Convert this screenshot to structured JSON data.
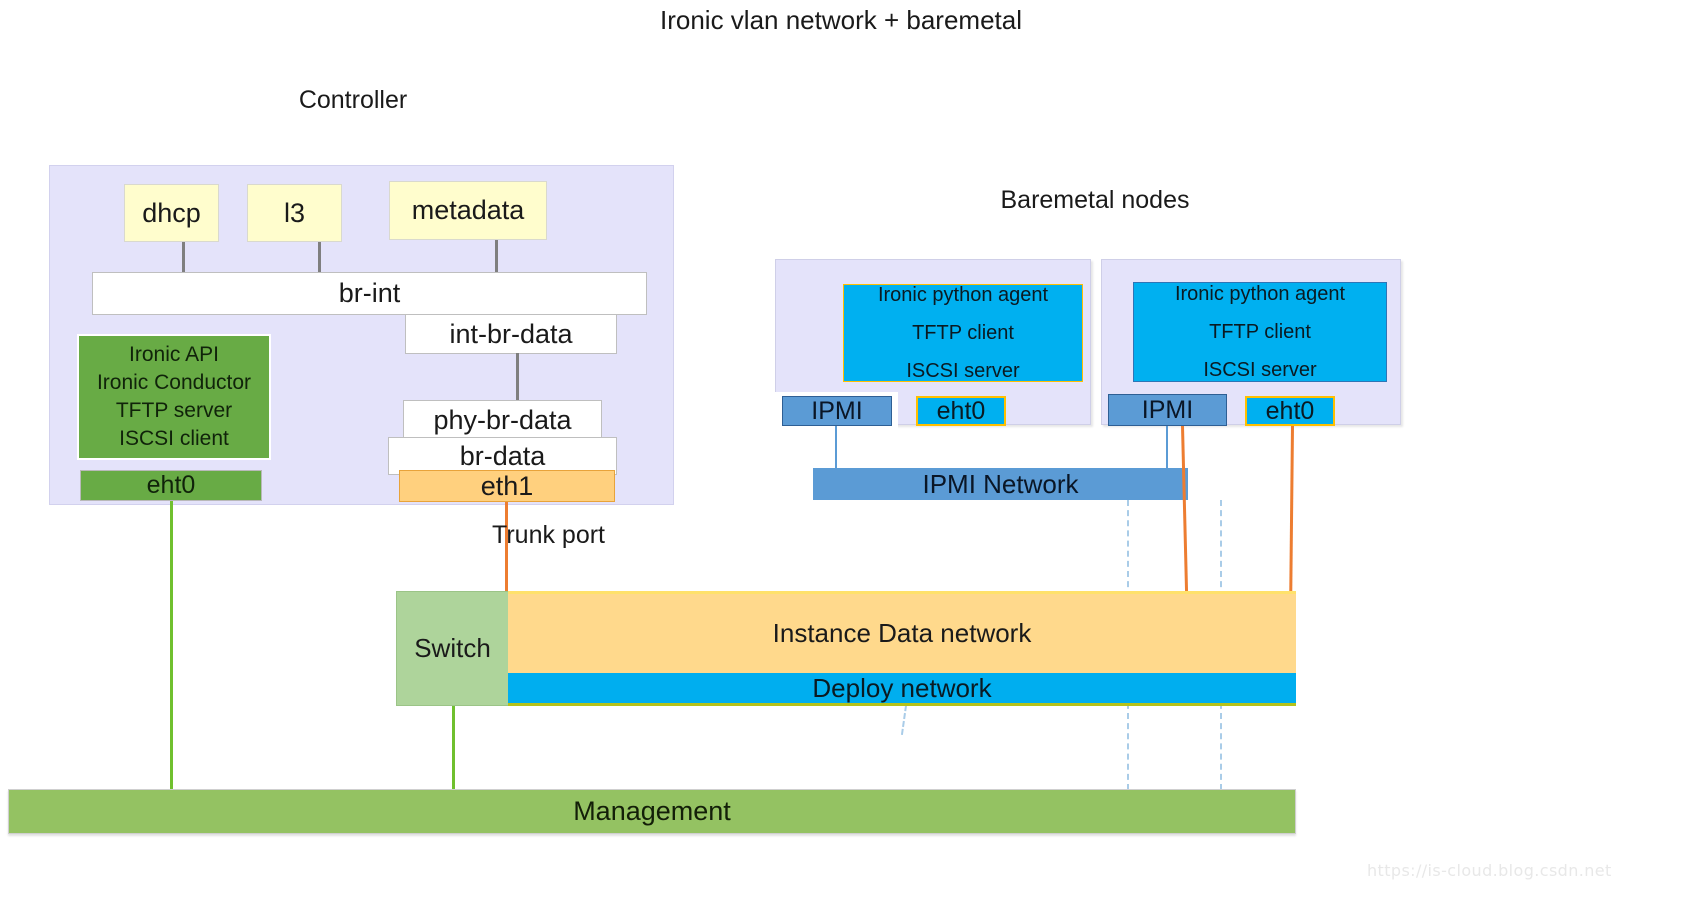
{
  "title": "Ironic vlan network + baremetal",
  "groups": {
    "controller_label": "Controller",
    "baremetal_label": "Baremetal nodes"
  },
  "controller": {
    "agents": [
      {
        "label": "dhcp"
      },
      {
        "label": "l3"
      },
      {
        "label": "metadata"
      }
    ],
    "bridges": {
      "br_int": "br-int",
      "int_br_data": "int-br-data",
      "phy_br_data": "phy-br-data",
      "br_data": "br-data"
    },
    "services": {
      "line1": "Ironic API",
      "line2": "Ironic Conductor",
      "line3": "TFTP server",
      "line4": "ISCSI client"
    },
    "nics": {
      "mgmt_nic": "eht0",
      "data_nic": "eth1"
    },
    "trunk_label": "Trunk port"
  },
  "baremetal_nodes": [
    {
      "services": {
        "line1": "Ironic python agent",
        "line2": "TFTP client",
        "line3": "ISCSI server"
      },
      "ipmi_label": "IPMI",
      "nic_label": "eht0"
    },
    {
      "services": {
        "line1": "Ironic python agent",
        "line2": "TFTP client",
        "line3": "ISCSI server"
      },
      "ipmi_label": "IPMI",
      "nic_label": "eht0"
    }
  ],
  "networks": {
    "ipmi": "IPMI Network",
    "instance_data": "Instance Data network",
    "deploy": "Deploy network",
    "management": "Management",
    "switch": "Switch"
  },
  "watermark": "https://is-cloud.blog.csdn.net",
  "colors": {
    "container": "#E4E3FA",
    "agent_yellow": "#FFFDCD",
    "service_green": "#68AB45",
    "nic_orange": "#FFD07E",
    "agent_cyan": "#00B0F0",
    "ipmi_blue": "#5B9BD5",
    "instance_network": "#FFD98C",
    "deploy_network": "#00AEEF",
    "management_green": "#94C262",
    "switch_green": "#AED49B",
    "trunk_line": "#ED7D31",
    "mgmt_line": "#70C02E"
  }
}
